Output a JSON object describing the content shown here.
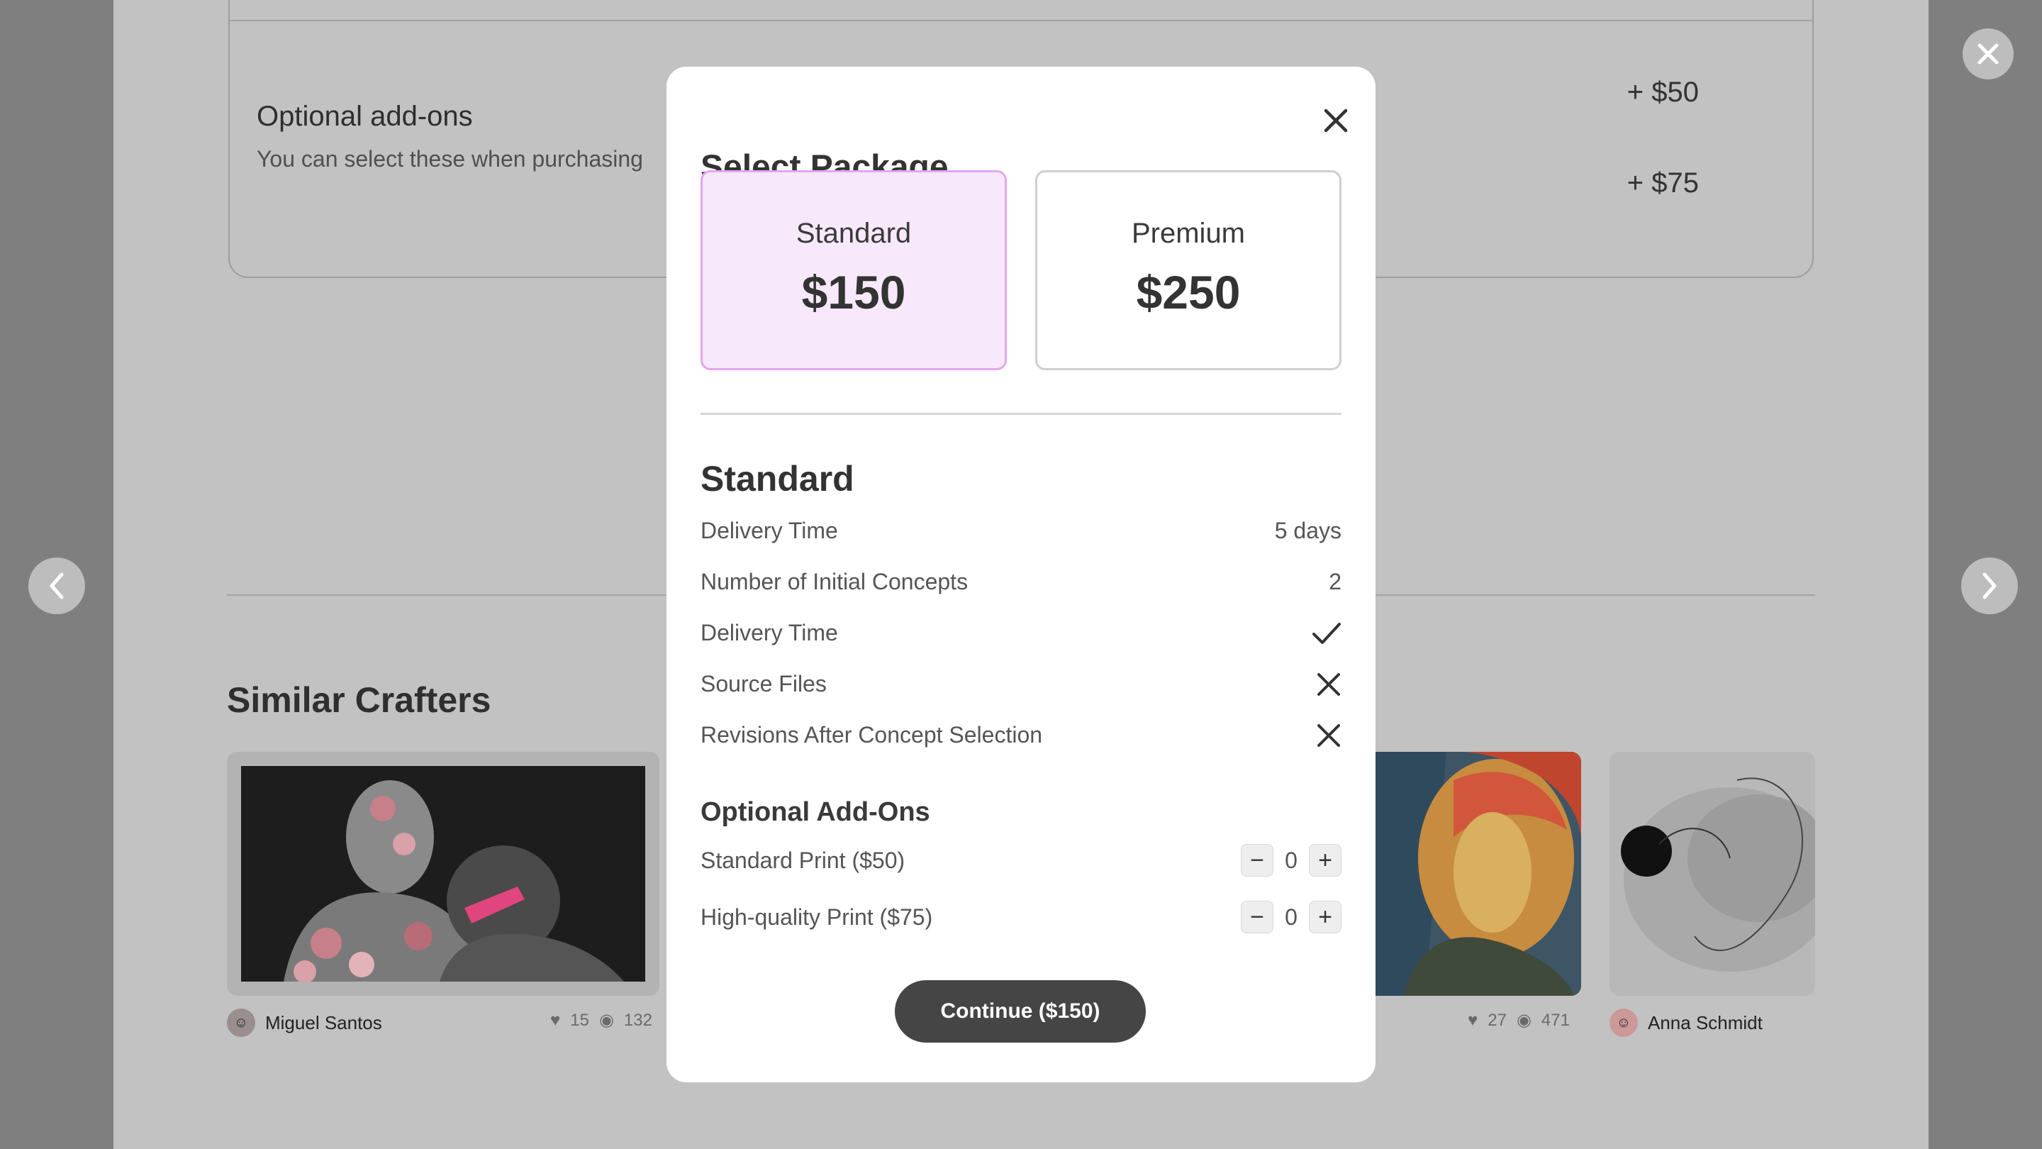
{
  "background": {
    "addons": {
      "title": "Optional add-ons",
      "subtitle": "You can select these when purchasing",
      "prices": [
        "+ $50",
        "+ $75"
      ]
    },
    "similar": {
      "title": "Similar Crafters",
      "cards": [
        {
          "name": "Miguel Santos",
          "likes": "15",
          "views": "132"
        },
        {
          "name": "",
          "likes": "27",
          "views": "471"
        },
        {
          "name": "Anna Schmidt",
          "likes": "",
          "views": ""
        }
      ]
    },
    "colors": {
      "overlay": "#7f7f7f",
      "page": "#c2c2c2"
    }
  },
  "modal": {
    "title": "Select Package",
    "packages": [
      {
        "name": "Standard",
        "price": "$150",
        "selected": true
      },
      {
        "name": "Premium",
        "price": "$250",
        "selected": false
      }
    ],
    "details_title": "Standard",
    "features": [
      {
        "label": "Delivery Time",
        "value": "5 days"
      },
      {
        "label": "Number of Initial Concepts",
        "value": "2"
      },
      {
        "label": "Delivery Time",
        "icon": "check-icon"
      },
      {
        "label": "Source Files",
        "icon": "x-icon"
      },
      {
        "label": "Revisions After Concept Selection",
        "icon": "x-icon"
      }
    ],
    "addons_title": "Optional Add-Ons",
    "addons": [
      {
        "label": "Standard Print ($50)",
        "qty": "0",
        "minus": "−",
        "plus": "+"
      },
      {
        "label": "High-quality Print ($75)",
        "qty": "0",
        "minus": "−",
        "plus": "+"
      }
    ],
    "continue_label": "Continue ($150)",
    "colors": {
      "selected_bg": "#f7e9fb",
      "selected_border": "#e3a6ef",
      "button": "#454545"
    }
  }
}
